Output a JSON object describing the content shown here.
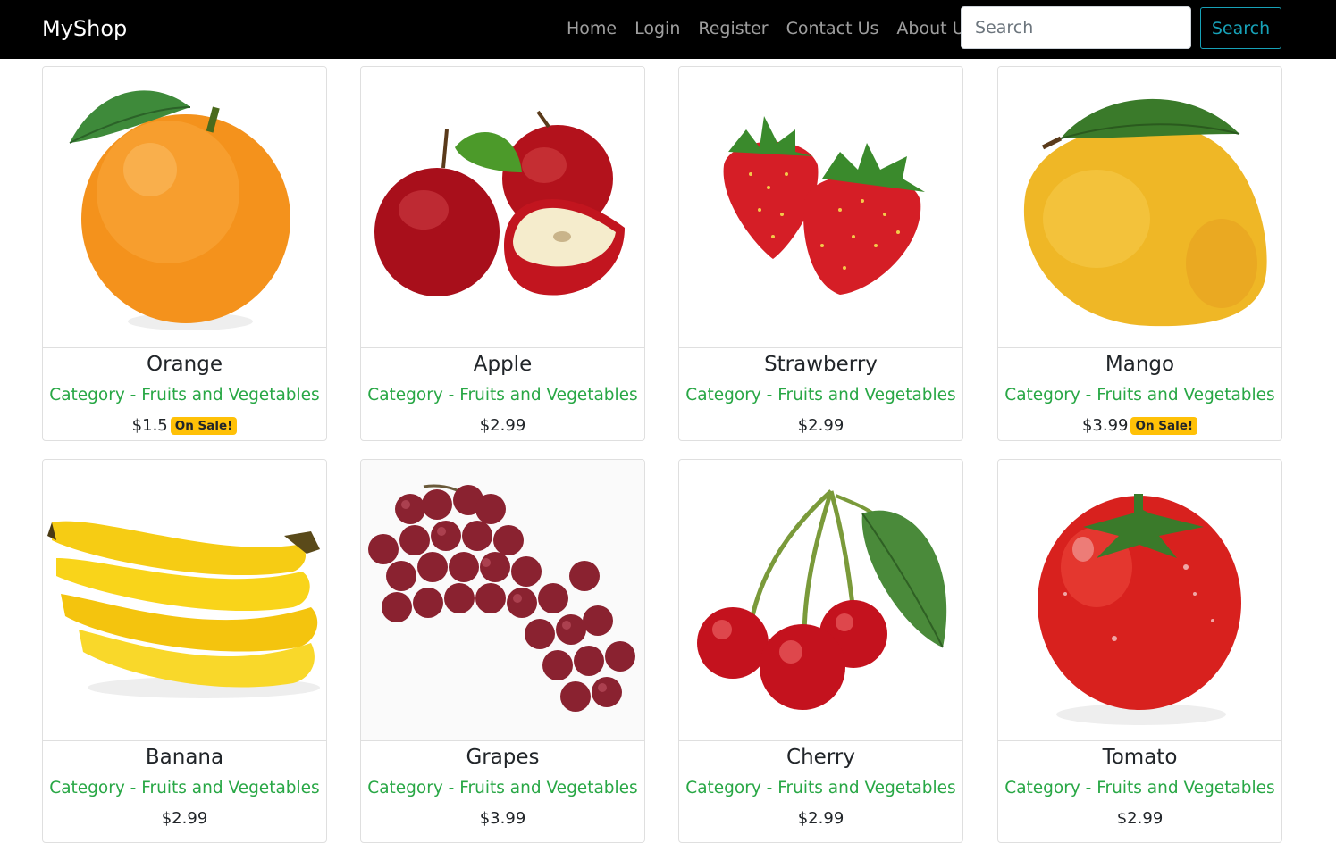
{
  "navbar": {
    "brand": "MyShop",
    "links": [
      "Home",
      "Login",
      "Register",
      "Contact Us",
      "About Us"
    ],
    "search_placeholder": "Search",
    "search_button": "Search"
  },
  "products": [
    {
      "name": "Orange",
      "category": "Category - Fruits and Vegetables",
      "price": "$1.5",
      "badge": "On Sale!",
      "image_icon": "orange-image"
    },
    {
      "name": "Apple",
      "category": "Category - Fruits and Vegetables",
      "price": "$2.99",
      "badge": "",
      "image_icon": "apple-image"
    },
    {
      "name": "Strawberry",
      "category": "Category - Fruits and Vegetables",
      "price": "$2.99",
      "badge": "",
      "image_icon": "strawberry-image"
    },
    {
      "name": "Mango",
      "category": "Category - Fruits and Vegetables",
      "price": "$3.99",
      "badge": "On Sale!",
      "image_icon": "mango-image"
    },
    {
      "name": "Banana",
      "category": "Category - Fruits and Vegetables",
      "price": "$2.99",
      "badge": "",
      "image_icon": "banana-image"
    },
    {
      "name": "Grapes",
      "category": "Category - Fruits and Vegetables",
      "price": "$3.99",
      "badge": "",
      "image_icon": "grapes-image"
    },
    {
      "name": "Cherry",
      "category": "Category - Fruits and Vegetables",
      "price": "$2.99",
      "badge": "",
      "image_icon": "cherry-image"
    },
    {
      "name": "Tomato",
      "category": "Category - Fruits and Vegetables",
      "price": "$2.99",
      "badge": "",
      "image_icon": "tomato-image"
    }
  ],
  "colors": {
    "navbar_bg": "#000000",
    "category_text": "#28a745",
    "search_button": "#17a2b8",
    "sale_badge": "#ffc107"
  }
}
